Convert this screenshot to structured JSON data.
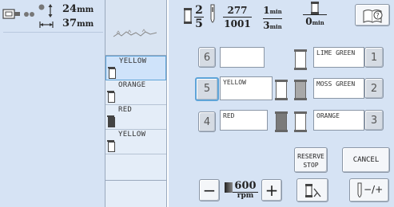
{
  "size": {
    "height": "24",
    "height_unit": "mm",
    "width": "37",
    "width_unit": "mm"
  },
  "thread_list": [
    {
      "name": "YELLOW",
      "number": "5",
      "selected": true
    },
    {
      "name": "ORANGE",
      "number": "3",
      "selected": false
    },
    {
      "name": "RED",
      "number": "4",
      "selected": false
    },
    {
      "name": "YELLOW",
      "number": "5",
      "selected": false
    }
  ],
  "status": {
    "color_current": "2",
    "color_total": "5",
    "stitch_current": "277",
    "stitch_total": "1001",
    "time_current": "1",
    "time_current_unit": "min",
    "time_total": "3",
    "time_total_unit": "min",
    "time_remaining": "0",
    "time_remaining_unit": "min"
  },
  "needle_slots": [
    {
      "number": "6",
      "name": "",
      "selected": false
    },
    {
      "number": "5",
      "name": "YELLOW",
      "selected": true
    },
    {
      "number": "4",
      "name": "RED",
      "selected": false
    }
  ],
  "spool_slots": [
    {
      "number": "1",
      "name": "LIME GREEN"
    },
    {
      "number": "2",
      "name": "MOSS GREEN"
    },
    {
      "number": "3",
      "name": "ORANGE"
    }
  ],
  "buttons": {
    "reserve_stop": "RESERVE STOP",
    "cancel": "CANCEL",
    "minus": "−",
    "plus": "+",
    "needle_toggle": "−/+"
  },
  "speed": {
    "value": "600",
    "unit": "rpm"
  },
  "colors": {
    "panel_bg": "#d6e3f4",
    "selection": "#5ea4d8"
  },
  "icons": [
    "frame-icon",
    "size-arrows-icon",
    "spool-icon",
    "needle-icon",
    "book-help-icon",
    "thread-trim-icon",
    "clock-icon"
  ]
}
